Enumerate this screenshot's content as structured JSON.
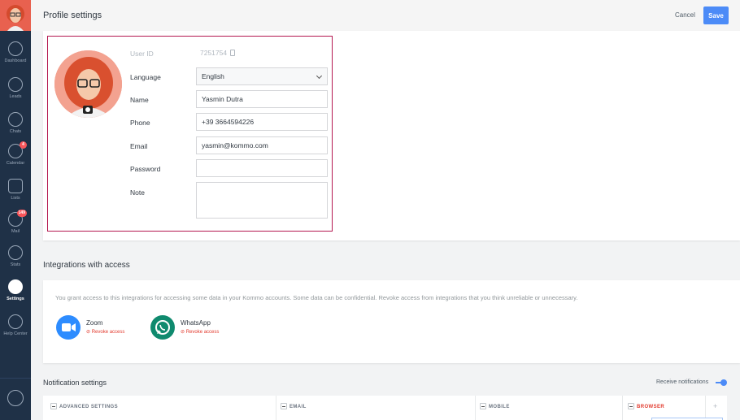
{
  "sidebar": {
    "items": [
      {
        "label": "Dashboard",
        "icon": "dashboard-icon",
        "badge": ""
      },
      {
        "label": "Leads",
        "icon": "dollar-icon",
        "badge": ""
      },
      {
        "label": "Chats",
        "icon": "chat-bubble-icon",
        "badge": ""
      },
      {
        "label": "Calendar",
        "icon": "checkmark-icon",
        "badge": "4"
      },
      {
        "label": "Lists",
        "icon": "list-icon",
        "badge": ""
      },
      {
        "label": "Mail",
        "icon": "mail-icon",
        "badge": "149"
      },
      {
        "label": "Stats",
        "icon": "stats-icon",
        "badge": ""
      },
      {
        "label": "Settings",
        "icon": "wrench-icon",
        "badge": ""
      },
      {
        "label": "Help Center",
        "icon": "help-icon",
        "badge": ""
      }
    ]
  },
  "header": {
    "title": "Profile settings",
    "cancel_label": "Cancel",
    "save_label": "Save"
  },
  "profile": {
    "user_id_label": "User ID",
    "user_id": "7251754",
    "language_label": "Language",
    "language": "English",
    "name_label": "Name",
    "name": "Yasmin Dutra",
    "phone_label": "Phone",
    "phone": "+39 3664594226",
    "email_label": "Email",
    "email": "yasmin@kommo.com",
    "password_label": "Password",
    "password": "",
    "note_label": "Note",
    "note": ""
  },
  "integrations": {
    "title": "Integrations with access",
    "description": "You grant access to this integrations for accessing some data in your Kommo accounts. Some data can be confidential. Revoke access from integrations that you think unreliable or unnecessary.",
    "items": [
      {
        "name": "Zoom",
        "revoke_label": "⊘ Revoke access",
        "color": "#2d8cff"
      },
      {
        "name": "WhatsApp",
        "revoke_label": "⊘ Revoke access",
        "color": "#0f8a6e"
      }
    ]
  },
  "notifications": {
    "title": "Notification settings",
    "receive_label": "Receive notifications",
    "receive_on": true,
    "columns": [
      "ADVANCED SETTINGS",
      "EMAIL",
      "MOBILE",
      "BROWSER"
    ]
  },
  "colors": {
    "sidebar_bg": "#1f3147",
    "accent": "#4c8bf7",
    "highlight_border": "#b4174f",
    "badge": "#f8555a",
    "revoke": "#e23a2e"
  }
}
